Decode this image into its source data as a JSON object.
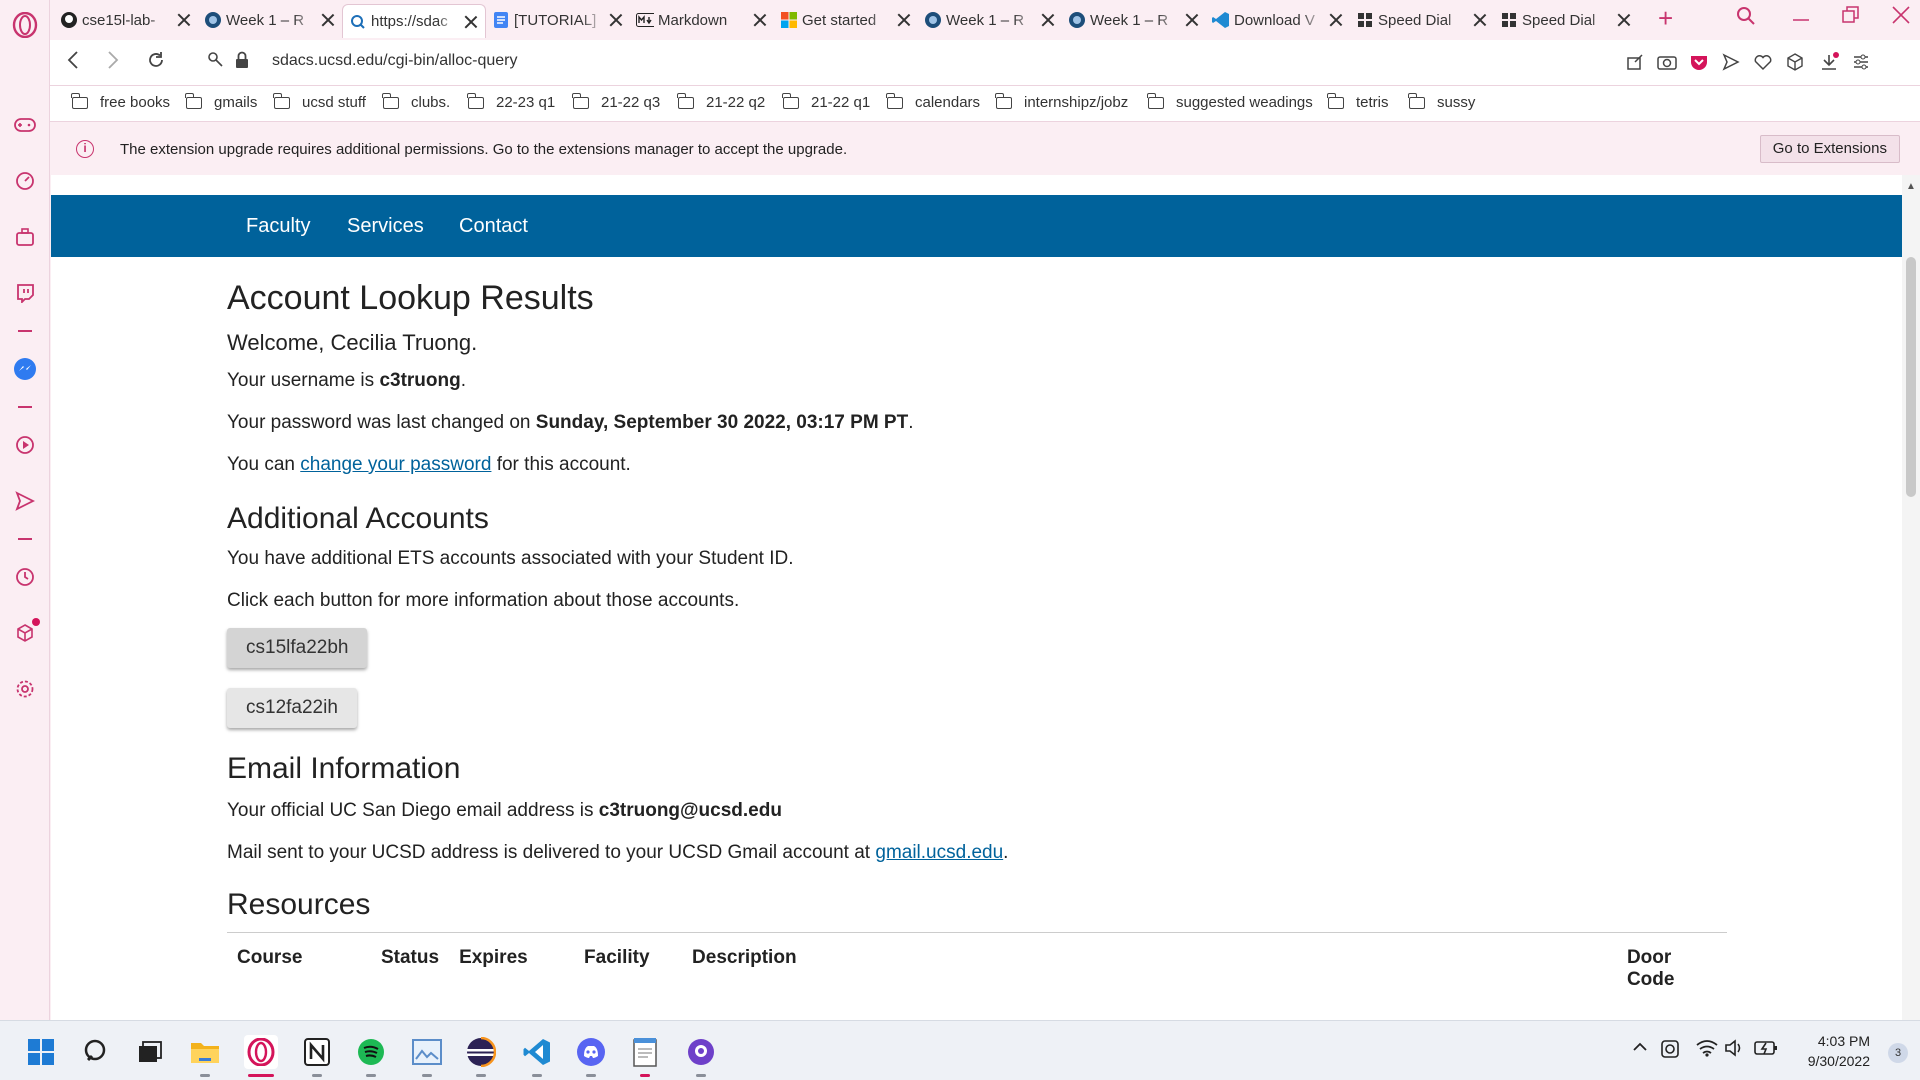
{
  "browser": {
    "tabs": [
      {
        "title": "cse15l-lab-",
        "icon": "github-icon",
        "active": false
      },
      {
        "title": "Week 1 – R",
        "icon": "ucsd-icon",
        "active": false
      },
      {
        "title": "https://sdac",
        "icon": "search-favicon",
        "active": true
      },
      {
        "title": "[TUTORIAL]",
        "icon": "docs-icon",
        "active": false
      },
      {
        "title": "Markdown",
        "icon": "markdown-icon",
        "active": false
      },
      {
        "title": "Get started",
        "icon": "windows-icon",
        "active": false
      },
      {
        "title": "Week 1 – R",
        "icon": "ucsd-icon",
        "active": false
      },
      {
        "title": "Week 1 – R",
        "icon": "ucsd-icon",
        "active": false
      },
      {
        "title": "Download V",
        "icon": "vscode-icon",
        "active": false
      },
      {
        "title": "Speed Dial",
        "icon": "speed-dial-icon",
        "active": false
      },
      {
        "title": "Speed Dial",
        "icon": "speed-dial-icon",
        "active": false
      }
    ],
    "url": "sdacs.ucsd.edu/cgi-bin/alloc-query",
    "bookmarks": [
      "free books",
      "gmails",
      "ucsd stuff",
      "clubs.",
      "22-23 q1",
      "21-22 q3",
      "21-22 q2",
      "21-22 q1",
      "calendars",
      "internshipz/jobz",
      "suggested weadings",
      "tetris",
      "sussy"
    ],
    "notice": {
      "message": "The extension upgrade requires additional permissions. Go to the extensions manager to accept the upgrade.",
      "button": "Go to Extensions"
    },
    "accent_color": "#c8346e"
  },
  "site": {
    "nav": [
      "Faculty",
      "Services",
      "Contact"
    ],
    "brand_color": "#00629b"
  },
  "page": {
    "title": "Account Lookup Results",
    "welcome": "Welcome, Cecilia Truong.",
    "username_prefix": "Your username is ",
    "username": "c3truong",
    "username_suffix": ".",
    "password_prefix": "Your password was last changed on ",
    "password_date": "Sunday, September 30 2022, 03:17 PM PT",
    "password_suffix": ".",
    "change_prefix": "You can ",
    "change_link": "change your password",
    "change_suffix": " for this account.",
    "additional_heading": "Additional Accounts",
    "additional_text1": "You have additional ETS accounts associated with your Student ID.",
    "additional_text2": "Click each button for more information about those accounts.",
    "accounts": [
      "cs15lfa22bh",
      "cs12fa22ih"
    ],
    "email_heading": "Email Information",
    "email_prefix": "Your official UC San Diego email address is ",
    "email_address": "c3truong@ucsd.edu",
    "mail_prefix": "Mail sent to your UCSD address is delivered to your UCSD Gmail account at ",
    "mail_link": "gmail.ucsd.edu",
    "mail_suffix": ".",
    "resources_heading": "Resources",
    "resources_columns": [
      "Course",
      "Status",
      "Expires",
      "Facility",
      "Description",
      "Door Code"
    ]
  },
  "taskbar": {
    "apps": [
      "start-icon",
      "search-icon",
      "task-view-icon",
      "file-explorer-icon",
      "opera-icon",
      "notion-icon",
      "spotify-icon",
      "image-viewer-icon",
      "eclipse-icon",
      "vscode-icon",
      "discord-icon",
      "notepad-icon",
      "github-desktop-icon"
    ],
    "time": "4:03 PM",
    "date": "9/30/2022",
    "notification_count": "3"
  }
}
